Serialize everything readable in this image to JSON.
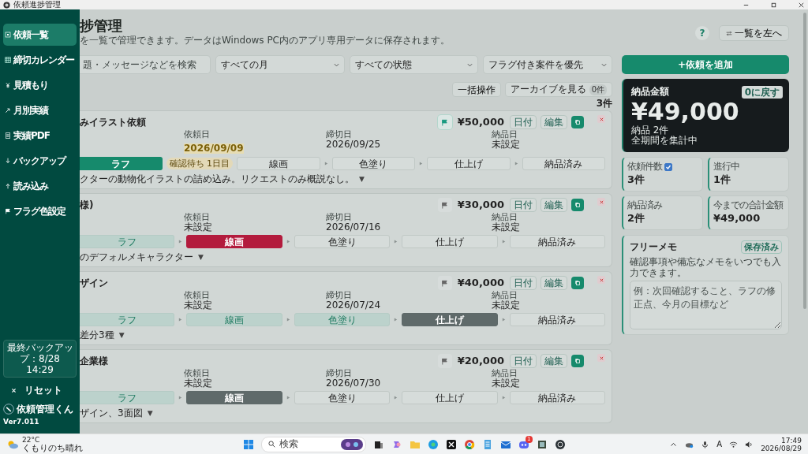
{
  "window": {
    "title": "依頼進捗管理"
  },
  "sidebar": {
    "items": [
      {
        "label": "依頼一覧",
        "selected": true
      },
      {
        "label": "締切カレンダー",
        "selected": false
      },
      {
        "label": "見積もり",
        "selected": false
      },
      {
        "label": "月別実績",
        "selected": false
      },
      {
        "label": "実績PDF",
        "selected": false
      },
      {
        "label": "バックアップ",
        "selected": false
      },
      {
        "label": "読み込み",
        "selected": false
      },
      {
        "label": "フラグ色設定",
        "selected": false
      }
    ],
    "backup": "最終バックアップ：8/28 14:29",
    "reset": "リセット",
    "app_name": "依頼管理くん",
    "version": "Ver7.011"
  },
  "header": {
    "title": "捗管理",
    "subtitle": "を一覧で管理できます。データはWindows PC内のアプリ専用データに保存されます。",
    "help": "?",
    "swap_button": "一覧を左へ"
  },
  "filters": {
    "search_placeholder": "題・メッセージなどを検索",
    "selects": [
      "すべての月",
      "すべての状態",
      "フラグ付き案件を優先"
    ]
  },
  "toolbar": {
    "bulk": "一括操作",
    "archive": "アーカイブを見る",
    "archive_count": "0件",
    "count": "3件"
  },
  "requests": [
    {
      "title": "みイラスト依頼",
      "flagged": true,
      "price": "¥50,000",
      "buttons": [
        "日付",
        "編集"
      ],
      "dates": [
        {
          "label": "依頼日",
          "value": "2026/09/09",
          "warning": true
        },
        {
          "label": "締切日",
          "value": "2026/09/25",
          "warning": false
        },
        {
          "label": "納品日",
          "value": "未設定",
          "warning": false
        }
      ],
      "color": "#168a6c",
      "badge": "確認待ち 1日目",
      "stages": [
        {
          "label": "ラフ",
          "done": false,
          "current": true
        },
        {
          "label": "線画",
          "done": false,
          "current": false
        },
        {
          "label": "色塗り",
          "done": false,
          "current": false
        },
        {
          "label": "仕上げ",
          "done": false,
          "current": false
        },
        {
          "label": "納品済み",
          "done": false,
          "current": false
        }
      ],
      "note": "クターの動物化イラストの詰め込み。リクエストのみ概説なし。",
      "expand": "▼"
    },
    {
      "title": "様)",
      "flagged": false,
      "price": "¥30,000",
      "buttons": [
        "日付",
        "編集"
      ],
      "dates": [
        {
          "label": "依頼日",
          "value": "未設定",
          "warning": false
        },
        {
          "label": "締切日",
          "value": "2026/07/16",
          "warning": false
        },
        {
          "label": "納品日",
          "value": "未設定",
          "warning": false
        }
      ],
      "color": "#b31b3d",
      "stages": [
        {
          "label": "ラフ",
          "done": true,
          "current": false
        },
        {
          "label": "線画",
          "done": false,
          "current": true
        },
        {
          "label": "色塗り",
          "done": false,
          "current": false
        },
        {
          "label": "仕上げ",
          "done": false,
          "current": false
        },
        {
          "label": "納品済み",
          "done": false,
          "current": false
        }
      ],
      "note": "のデフォルメキャラクター",
      "expand": "▼"
    },
    {
      "title": "ザイン",
      "flagged": false,
      "price": "¥40,000",
      "buttons": [
        "日付",
        "編集"
      ],
      "dates": [
        {
          "label": "依頼日",
          "value": "未設定",
          "warning": false
        },
        {
          "label": "締切日",
          "value": "2026/07/24",
          "warning": false
        },
        {
          "label": "納品日",
          "value": "未設定",
          "warning": false
        }
      ],
      "color": "#5f6a6a",
      "stages": [
        {
          "label": "ラフ",
          "done": true,
          "current": false
        },
        {
          "label": "線画",
          "done": true,
          "current": false
        },
        {
          "label": "色塗り",
          "done": true,
          "current": false
        },
        {
          "label": "仕上げ",
          "done": false,
          "current": true
        },
        {
          "label": "納品済み",
          "done": false,
          "current": false
        }
      ],
      "note": "差分3種",
      "expand": "▼"
    },
    {
      "title": "企業様",
      "flagged": false,
      "price": "¥20,000",
      "buttons": [
        "日付",
        "編集"
      ],
      "dates": [
        {
          "label": "依頼日",
          "value": "未設定",
          "warning": false
        },
        {
          "label": "締切日",
          "value": "2026/07/30",
          "warning": false
        },
        {
          "label": "納品日",
          "value": "未設定",
          "warning": false
        }
      ],
      "color": "#5f6a6a",
      "stages": [
        {
          "label": "ラフ",
          "done": true,
          "current": false
        },
        {
          "label": "線画",
          "done": false,
          "current": true
        },
        {
          "label": "色塗り",
          "done": false,
          "current": false
        },
        {
          "label": "仕上げ",
          "done": false,
          "current": false
        },
        {
          "label": "納品済み",
          "done": false,
          "current": false
        }
      ],
      "note": "ザイン、3面図",
      "expand": "▼"
    }
  ],
  "add_button": "+依頼を追加",
  "total": {
    "label": "納品金額",
    "reset_button": "0に戻す",
    "amount": "¥49,000",
    "count": "納品 2件",
    "period": "全期間を集計中"
  },
  "stats_toggle": {
    "checked": true
  },
  "stats": [
    {
      "label": "依頼件数",
      "value": "3件"
    },
    {
      "label": "進行中",
      "value": "1件"
    },
    {
      "label": "納品済み",
      "value": "2件"
    },
    {
      "label": "今までの合計金額",
      "value": "¥49,000"
    }
  ],
  "memo": {
    "title": "フリーメモ",
    "status": "保存済み",
    "hint": "確認事項や備忘なメモをいつでも入力できます。",
    "placeholder": "例：次回確認すること、ラフの修正点、今月の目標など"
  },
  "taskbar": {
    "temperature": "22°C",
    "weather": "くもりのち晴れ",
    "search_placeholder": "検索",
    "notification_count": "1",
    "ime": "A",
    "time": "17:49",
    "date": "2026/08/29"
  }
}
